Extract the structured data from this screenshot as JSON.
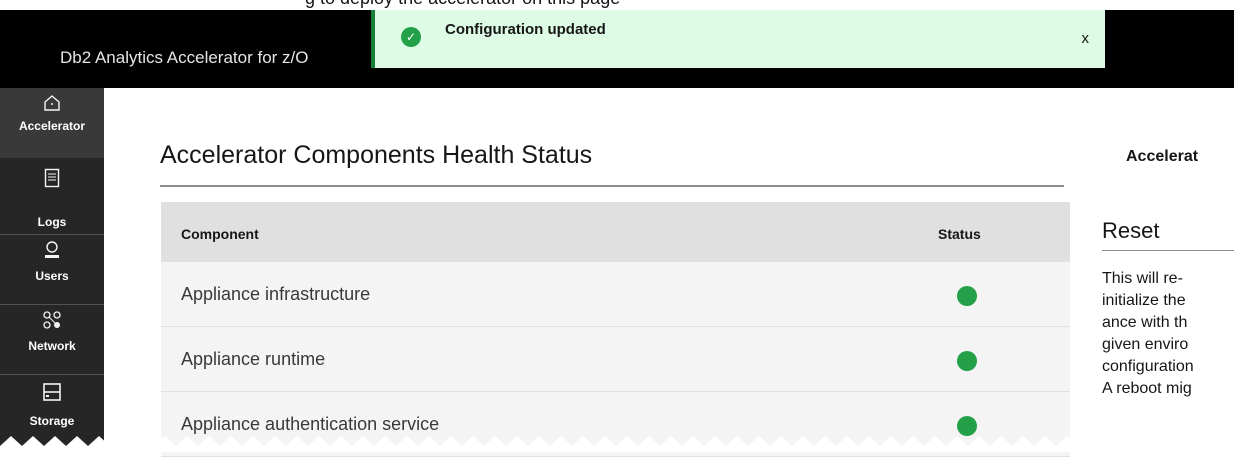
{
  "topbar": {
    "caption_fragment": "g to deploy the accelerator on this page",
    "app_title": "Db2 Analytics Accelerator for z/O"
  },
  "toast": {
    "icon": "checkmark-filled-icon",
    "title": "Configuration updated",
    "close_label": "x"
  },
  "sidebar": {
    "items": [
      {
        "label": "Accelerator",
        "icon": "home-icon",
        "active": true
      },
      {
        "label": "Logs",
        "icon": "document-icon",
        "active": false
      },
      {
        "label": "Users",
        "icon": "user-icon",
        "active": false
      },
      {
        "label": "Network",
        "icon": "network-icon",
        "active": false
      },
      {
        "label": "Storage",
        "icon": "storage-icon",
        "active": false
      }
    ]
  },
  "main": {
    "title": "Accelerator Components Health Status",
    "table": {
      "headers": [
        "Component",
        "Status"
      ],
      "rows": [
        {
          "component": "Appliance infrastructure",
          "status": "green"
        },
        {
          "component": "Appliance runtime",
          "status": "green"
        },
        {
          "component": "Appliance authentication service",
          "status": "green"
        }
      ]
    }
  },
  "right_panel": {
    "heading": "Accelerat",
    "reset": {
      "title": "Reset",
      "lines": [
        "This will re-",
        "initialize the",
        "ance with th",
        "given enviro",
        "configuration",
        "A reboot mig"
      ]
    }
  },
  "colors": {
    "status_ok": "#24a148",
    "toast_bg": "#defbe6",
    "topbar_bg": "#000000",
    "sidebar_bg": "#262626"
  }
}
